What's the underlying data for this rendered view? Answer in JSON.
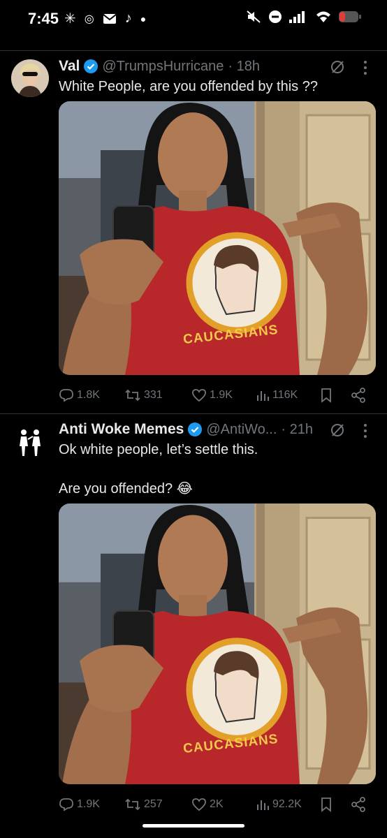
{
  "status_bar": {
    "time": "7:45"
  },
  "tweets": [
    {
      "name": "Val",
      "handle": "@TrumpsHurricane",
      "time": "· 18h",
      "text": "White People, are you offended by this ??",
      "shirt_text": "CAUCASIANS",
      "stats": {
        "replies": "1.8K",
        "reposts": "331",
        "likes": "1.9K",
        "views": "116K"
      }
    },
    {
      "name": "Anti Woke Memes",
      "handle": "@AntiWo...",
      "time": "· 21h",
      "text_line1": "Ok white people, let’s settle this.",
      "text_line2": "Are you offended? 😂",
      "shirt_text": "CAUCASIANS",
      "stats": {
        "replies": "1.9K",
        "reposts": "257",
        "likes": "2K",
        "views": "92.2K"
      }
    }
  ],
  "icons": [
    "verified-badge-icon",
    "grok-icon",
    "more-options-icon",
    "reply-icon",
    "repost-icon",
    "like-icon",
    "views-icon",
    "bookmark-icon",
    "share-icon"
  ],
  "colors": {
    "verified": "#1d9bf0",
    "muted": "#71767b",
    "text": "#e7e9ea",
    "shirt": "#b8272a"
  }
}
